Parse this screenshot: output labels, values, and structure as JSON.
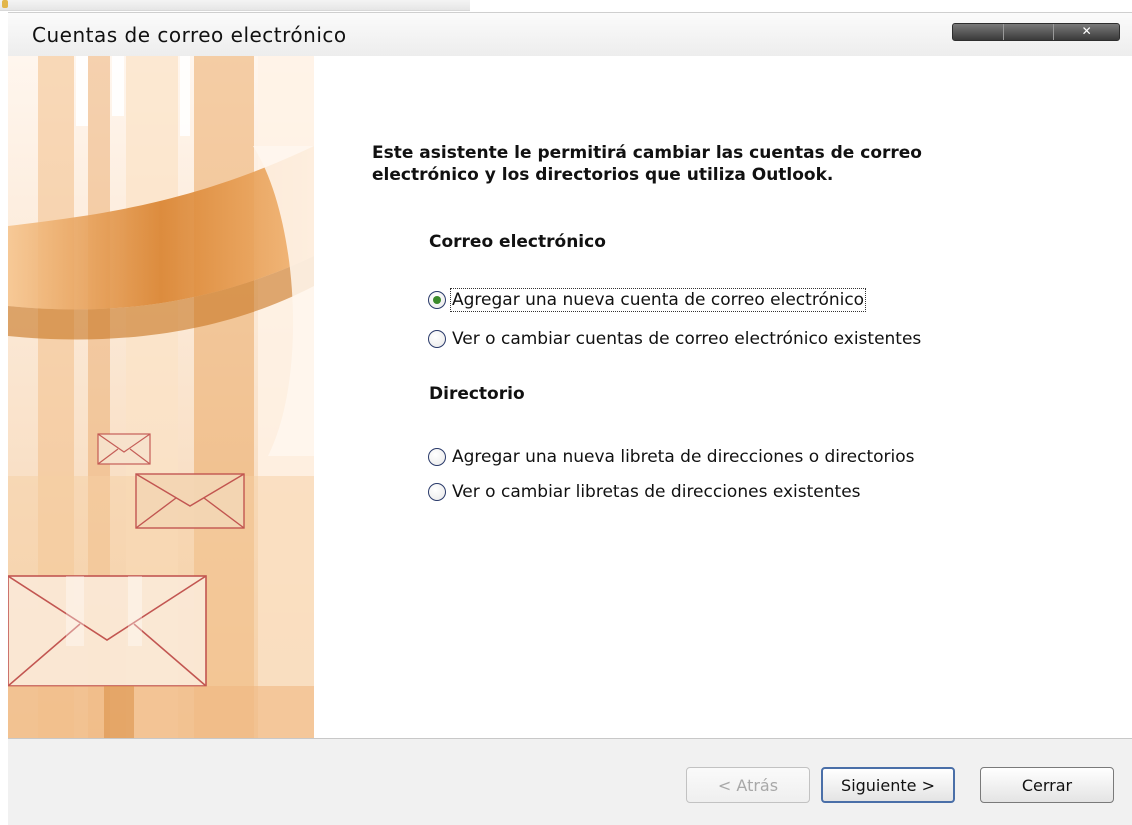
{
  "window": {
    "title": "Cuentas de correo electrónico"
  },
  "content": {
    "intro": "Este asistente le permitirá cambiar las cuentas de correo electrónico y los directorios que utiliza Outlook.",
    "email_section": {
      "heading": "Correo electrónico",
      "options": [
        {
          "label": "Agregar una nueva cuenta de correo electrónico",
          "checked": true
        },
        {
          "label": "Ver o cambiar cuentas de correo electrónico existentes",
          "checked": false
        }
      ]
    },
    "directory_section": {
      "heading": "Directorio",
      "options": [
        {
          "label": "Agregar una nueva libreta de direcciones o directorios",
          "checked": false
        },
        {
          "label": "Ver o cambiar libretas de direcciones existentes",
          "checked": false
        }
      ]
    }
  },
  "buttons": {
    "back": "< Atrás",
    "next": "Siguiente >",
    "close": "Cerrar"
  },
  "colors": {
    "accent": "#4a6fa8",
    "art_orange": "#e89a4a",
    "envelope_line": "#c0504d"
  }
}
